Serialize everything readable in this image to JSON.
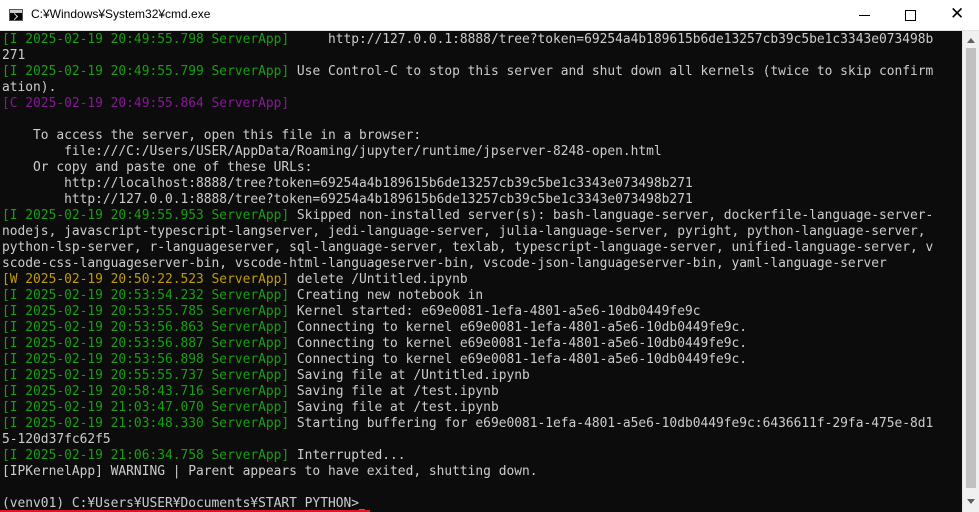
{
  "window": {
    "title": "C:¥Windows¥System32¥cmd.exe",
    "icon": "cmd-icon",
    "controls": {
      "minimize": "─",
      "maximize": "☐",
      "close": "✕"
    }
  },
  "colors": {
    "background": "#0c0c0c",
    "text": "#cccccc",
    "info_green": "#13a10e",
    "critical_purple": "#881798",
    "warning_yellow": "#c19c00"
  },
  "console": {
    "lines": [
      {
        "prefix": "[I 2025-02-19 20:49:55.798 ServerApp]",
        "text": "     http://127.0.0.1:8888/tree?token=69254a4b189615b6de13257cb39c5be1c3343e073498b"
      },
      {
        "prefix": "",
        "text": "271"
      },
      {
        "prefix": "[I 2025-02-19 20:49:55.799 ServerApp]",
        "text": " Use Control-C to stop this server and shut down all kernels (twice to skip confirm"
      },
      {
        "prefix": "",
        "text": "ation)."
      },
      {
        "prefix": "[C 2025-02-19 20:49:55.864 ServerApp]",
        "text": ""
      },
      {
        "prefix": "",
        "text": ""
      },
      {
        "prefix": "",
        "text": "    To access the server, open this file in a browser:"
      },
      {
        "prefix": "",
        "text": "        file:///C:/Users/USER/AppData/Roaming/jupyter/runtime/jpserver-8248-open.html"
      },
      {
        "prefix": "",
        "text": "    Or copy and paste one of these URLs:"
      },
      {
        "prefix": "",
        "text": "        http://localhost:8888/tree?token=69254a4b189615b6de13257cb39c5be1c3343e073498b271"
      },
      {
        "prefix": "",
        "text": "        http://127.0.0.1:8888/tree?token=69254a4b189615b6de13257cb39c5be1c3343e073498b271"
      },
      {
        "prefix": "[I 2025-02-19 20:49:55.953 ServerApp]",
        "text": " Skipped non-installed server(s): bash-language-server, dockerfile-language-server-"
      },
      {
        "prefix": "",
        "text": "nodejs, javascript-typescript-langserver, jedi-language-server, julia-language-server, pyright, python-language-server,"
      },
      {
        "prefix": "",
        "text": "python-lsp-server, r-languageserver, sql-language-server, texlab, typescript-language-server, unified-language-server, v"
      },
      {
        "prefix": "",
        "text": "scode-css-languageserver-bin, vscode-html-languageserver-bin, vscode-json-languageserver-bin, yaml-language-server"
      },
      {
        "prefix": "[W 2025-02-19 20:50:22.523 ServerApp]",
        "text": " delete /Untitled.ipynb"
      },
      {
        "prefix": "[I 2025-02-19 20:53:54.232 ServerApp]",
        "text": " Creating new notebook in"
      },
      {
        "prefix": "[I 2025-02-19 20:53:55.785 ServerApp]",
        "text": " Kernel started: e69e0081-1efa-4801-a5e6-10db0449fe9c"
      },
      {
        "prefix": "[I 2025-02-19 20:53:56.863 ServerApp]",
        "text": " Connecting to kernel e69e0081-1efa-4801-a5e6-10db0449fe9c."
      },
      {
        "prefix": "[I 2025-02-19 20:53:56.887 ServerApp]",
        "text": " Connecting to kernel e69e0081-1efa-4801-a5e6-10db0449fe9c."
      },
      {
        "prefix": "[I 2025-02-19 20:53:56.898 ServerApp]",
        "text": " Connecting to kernel e69e0081-1efa-4801-a5e6-10db0449fe9c."
      },
      {
        "prefix": "[I 2025-02-19 20:55:55.737 ServerApp]",
        "text": " Saving file at /Untitled.ipynb"
      },
      {
        "prefix": "[I 2025-02-19 20:58:43.716 ServerApp]",
        "text": " Saving file at /test.ipynb"
      },
      {
        "prefix": "[I 2025-02-19 21:03:47.070 ServerApp]",
        "text": " Saving file at /test.ipynb"
      },
      {
        "prefix": "[I 2025-02-19 21:03:48.330 ServerApp]",
        "text": " Starting buffering for e69e0081-1efa-4801-a5e6-10db0449fe9c:6436611f-29fa-475e-8d1"
      },
      {
        "prefix": "",
        "text": "5-120d37fc62f5"
      },
      {
        "prefix": "[I 2025-02-19 21:06:34.758 ServerApp]",
        "text": " Interrupted..."
      },
      {
        "prefix": "",
        "text": "[IPKernelApp] WARNING | Parent appears to have exited, shutting down."
      },
      {
        "prefix": "",
        "text": ""
      },
      {
        "prefix": "",
        "text": "(venv01) C:¥Users¥USER¥Documents¥START PYTHON>"
      }
    ]
  }
}
